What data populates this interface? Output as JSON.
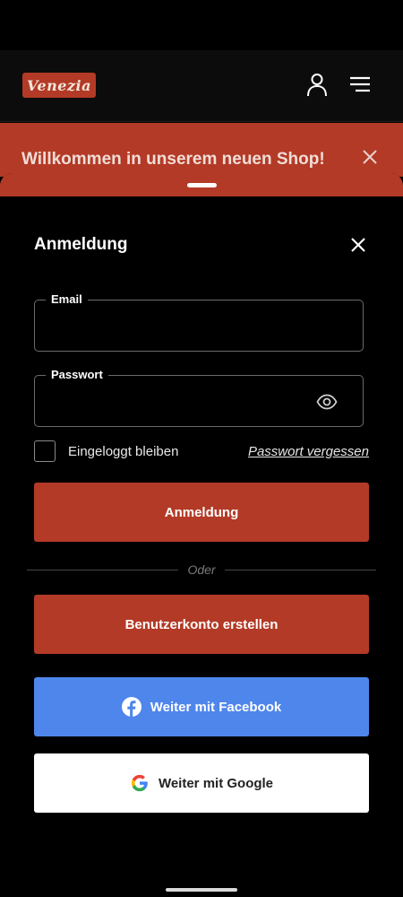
{
  "header": {
    "logo_text": "Venezia",
    "icons": [
      "user-icon",
      "menu-icon"
    ]
  },
  "banner": {
    "text": "Willkommen in unserem neuen Shop!",
    "close_icon": "close-icon"
  },
  "login": {
    "title": "Anmeldung",
    "email_label": "Email",
    "email_value": "",
    "password_label": "Passwort",
    "password_value": "",
    "remember_label": "Eingeloggt bleiben",
    "forgot_label": "Passwort vergessen",
    "submit_label": "Anmeldung",
    "divider_text": "Oder",
    "register_label": "Benutzerkonto erstellen",
    "facebook_label": "Weiter mit Facebook",
    "google_label": "Weiter mit Google"
  },
  "colors": {
    "brand": "#b33a26",
    "facebook": "#4f86ec",
    "background": "#000000"
  }
}
